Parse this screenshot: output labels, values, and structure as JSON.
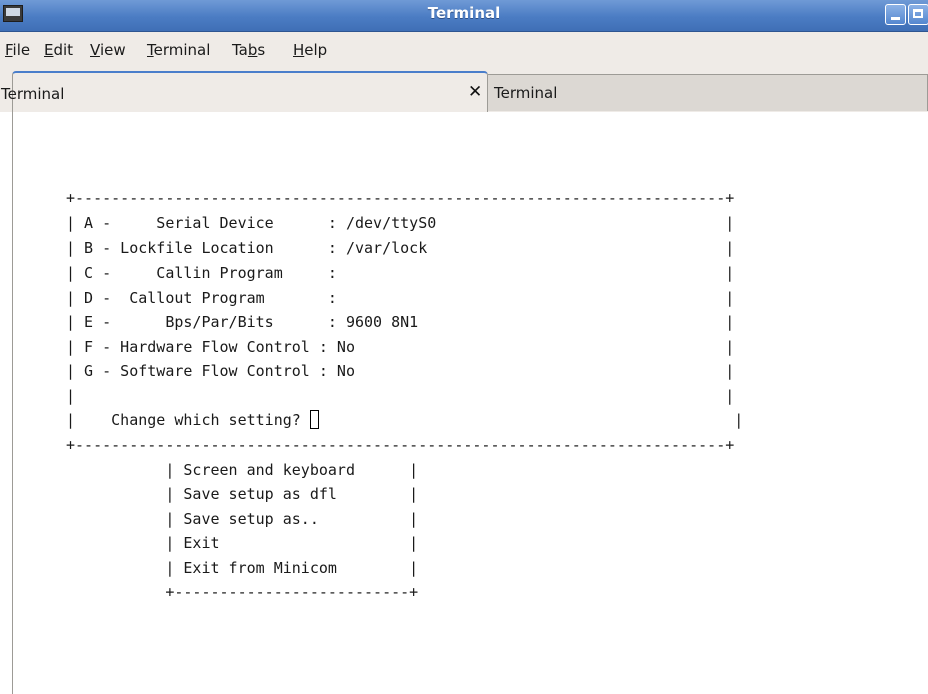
{
  "window": {
    "title": "Terminal",
    "icon": "terminal-app-icon",
    "buttons": [
      "minimize-icon",
      "maximize-icon"
    ]
  },
  "menubar": [
    {
      "label": "File",
      "mnemonic": "F",
      "rest": "ile"
    },
    {
      "label": "Edit",
      "mnemonic": "E",
      "rest": "dit"
    },
    {
      "label": "View",
      "mnemonic": "V",
      "rest": "iew"
    },
    {
      "label": "Terminal",
      "mnemonic": "T",
      "rest": "erminal"
    },
    {
      "label": "Tabs",
      "pre": "Ta",
      "mnemonic": "b",
      "rest": "s"
    },
    {
      "label": "Help",
      "mnemonic": "H",
      "rest": "elp"
    }
  ],
  "tabs": [
    {
      "label": "Terminal",
      "active": true,
      "close": "✕"
    },
    {
      "label": "Terminal",
      "active": false
    }
  ],
  "terminal": {
    "lines": [
      "+------------------------------------------------------------------------+",
      "| A -     Serial Device      : /dev/ttyS0                                |",
      "| B - Lockfile Location      : /var/lock                                 |",
      "| C -     Callin Program     :                                           |",
      "| D -  Callout Program       :                                           |",
      "| E -      Bps/Par/Bits      : 9600 8N1                                  |",
      "| F - Hardware Flow Control : No                                         |",
      "| G - Software Flow Control : No                                         |",
      "|                                                                        |",
      "|    Change which setting? ",
      "+------------------------------------------------------------------------+",
      "           | Screen and keyboard      |",
      "           | Save setup as dfl        |",
      "           | Save setup as..          |",
      "           | Exit                     |",
      "           | Exit from Minicom        |",
      "           +--------------------------+"
    ],
    "prompt_tail": "                                              |"
  }
}
